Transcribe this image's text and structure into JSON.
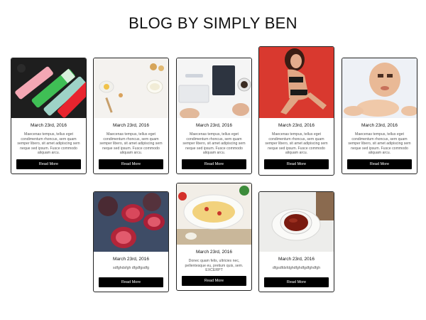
{
  "page": {
    "title": "BLOG BY SIMPLY BEN"
  },
  "posts": [
    {
      "date": "March 23rd, 2016",
      "excerpt": "Maecenas tempus, tellus eget condimentum rhoncus, sem quam semper libero, sit amet adipiscing sem neque sed ipsum. Fusce commodo aliquam arcu.",
      "button": "Read More",
      "image": "markers"
    },
    {
      "date": "March 23rd, 2016",
      "excerpt": "Maecenas tempus, tellus eget condimentum rhoncus, sem quam semper libero, sit amet adipiscing sem neque sed ipsum. Fusce commodo aliquam arcu.",
      "button": "Read More",
      "image": "baking"
    },
    {
      "date": "March 23rd, 2016",
      "excerpt": "Maecenas tempus, tellus eget condimentum rhoncus, sem quam semper libero, sit amet adipiscing sem neque sed ipsum. Fusce commodo aliquam arcu.",
      "button": "Read More",
      "image": "desk"
    },
    {
      "date": "March 23rd, 2016",
      "excerpt": "Maecenas tempus, tellus eget condimentum rhoncus, sem quam semper libero, sit amet adipiscing sem neque sed ipsum. Fusce commodo aliquam arcu.",
      "button": "Read More",
      "image": "model"
    },
    {
      "date": "March 23rd, 2016",
      "excerpt": "Maecenas tempus, tellus eget condimentum rhoncus, sem quam semper libero, sit amet adipiscing sem neque sed ipsum. Fusce commodo aliquam arcu.",
      "button": "Read More",
      "image": "baby"
    },
    {
      "date": "March 23rd, 2016",
      "excerpt": "sdfghdsfgh dfgdfgsdfg",
      "button": "Read More",
      "image": "figs"
    },
    {
      "date": "March 23rd, 2016",
      "excerpt": "Donec quam felis, ultricies nec, pellentesque eu, pretium quis, sem. EXCERPT",
      "button": "Read More",
      "image": "pasta"
    },
    {
      "date": "March 23rd, 2016",
      "excerpt": "dfgsdfdsfdghdfghdfgdfghdfgh",
      "button": "Read More",
      "image": "tea"
    }
  ],
  "colors": {
    "button_bg": "#000000",
    "button_text": "#ffffff",
    "border": "#222222"
  }
}
